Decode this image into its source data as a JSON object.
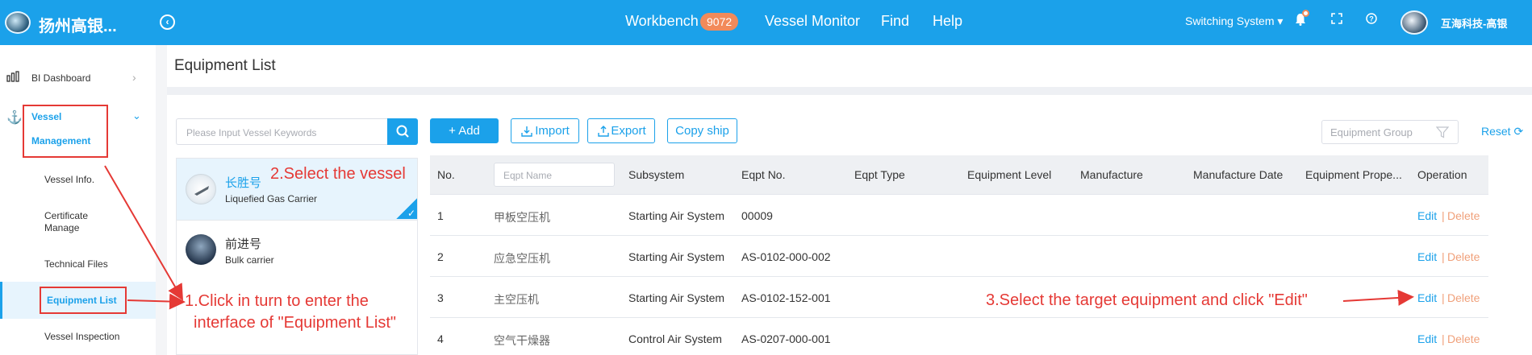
{
  "header": {
    "app_name": "扬州高银...",
    "collapse_icon": "circle-arrow-left-icon",
    "nav": [
      {
        "label": "Workbench",
        "badge": "9072"
      },
      {
        "label": "Vessel Monitor"
      },
      {
        "label": "Find"
      },
      {
        "label": "Help"
      }
    ],
    "switch_label": "Switching System ▾",
    "icons": [
      "bell-icon",
      "fullscreen-icon",
      "help-icon"
    ],
    "user_name": "互海科技-高银"
  },
  "sidebar": {
    "items": [
      {
        "label": "BI Dashboard",
        "icon": "bar-chart-icon"
      },
      {
        "label": "Vessel Management",
        "label_line1": "Vessel",
        "label_line2": "Management",
        "icon": "anchor-icon"
      }
    ],
    "sub_items": [
      {
        "label": "Vessel Info."
      },
      {
        "label": "Certificate",
        "label2": "Manage"
      },
      {
        "label": "Technical Files"
      },
      {
        "label": "Equipment List",
        "active": true
      },
      {
        "label": "Vessel Inspection"
      }
    ]
  },
  "page": {
    "title": "Equipment List"
  },
  "vessel_panel": {
    "search_placeholder": "Please Input Vessel Keywords",
    "vessels": [
      {
        "name": "长胜号",
        "type": "Liquefied Gas Carrier",
        "selected": true
      },
      {
        "name": "前进号",
        "type": "Bulk carrier",
        "selected": false
      }
    ]
  },
  "toolbar": {
    "add": "+ Add",
    "import": "Import",
    "export": "Export",
    "copy": "Copy ship",
    "group_placeholder": "Equipment Group",
    "reset": "Reset"
  },
  "table": {
    "columns": [
      "No.",
      "Eqpt Name",
      "Subsystem",
      "Eqpt No.",
      "Eqpt Type",
      "Equipment Level",
      "Manufacture",
      "Manufacture Date",
      "Equipment Prope...",
      "Operation"
    ],
    "eqpt_name_placeholder": "Eqpt Name",
    "rows": [
      {
        "no": "1",
        "name": "甲板空压机",
        "subsystem": "Starting Air System",
        "eqpt_no": "00009"
      },
      {
        "no": "2",
        "name": "应急空压机",
        "subsystem": "Starting Air System",
        "eqpt_no": "AS-0102-000-002"
      },
      {
        "no": "3",
        "name": "主空压机",
        "subsystem": "Starting Air System",
        "eqpt_no": "AS-0102-152-001"
      },
      {
        "no": "4",
        "name": "空气干燥器",
        "subsystem": "Control Air System",
        "eqpt_no": "AS-0207-000-001"
      }
    ],
    "edit_label": "Edit",
    "sep": "|",
    "delete_label": "Delete"
  },
  "annotations": {
    "step1_line1": "1.Click in turn to enter the",
    "step1_line2": "interface of \"Equipment List\"",
    "step2": "2.Select the vessel",
    "step3": "3.Select the target equipment and click \"Edit\""
  },
  "colors": {
    "primary": "#1ba1ea",
    "badge": "#f28a5a",
    "delete": "#f0a07a",
    "annotation": "#e53935"
  }
}
